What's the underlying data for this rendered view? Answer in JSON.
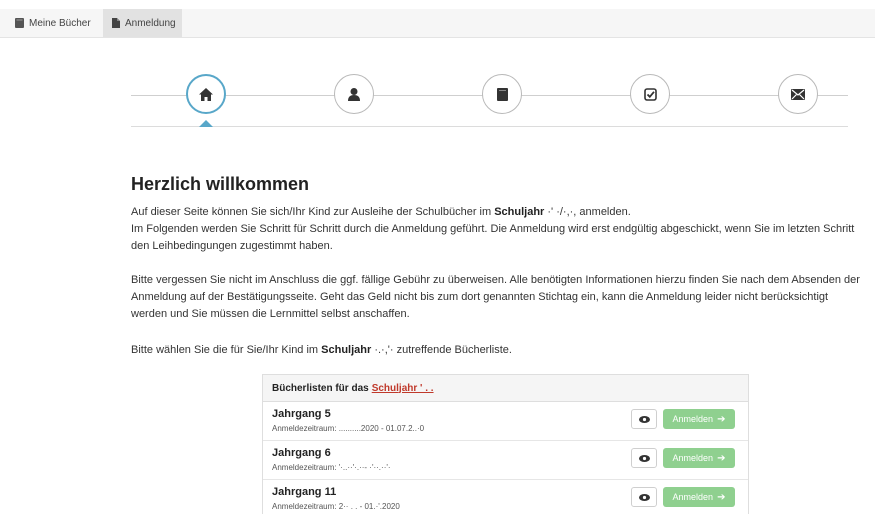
{
  "nav": {
    "tabs": [
      {
        "label": "Meine Bücher",
        "icon": "book-icon"
      },
      {
        "label": "Anmeldung",
        "icon": "document-icon"
      }
    ],
    "active_tab": "Anmeldung"
  },
  "stepper": {
    "steps": [
      "home-icon",
      "user-icon",
      "book-icon",
      "check-square-icon",
      "envelope-icon"
    ],
    "active": 0,
    "accent": "#58a7c9"
  },
  "content": {
    "title": "Herzlich willkommen",
    "p1_a": "Auf dieser Seite können Sie sich/Ihr Kind zur Ausleihe der Schulbücher im ",
    "p1_bold": "Schuljahr",
    "p1_b": " ·' ·/·,·, anmelden.",
    "p1_c": "Im Folgenden werden Sie Schritt für Schritt durch die Anmeldung geführt. Die Anmeldung wird erst endgültig abgeschickt, wenn Sie im letzten Schritt den Leihbedingungen zugestimmt haben.",
    "p2": "Bitte vergessen Sie nicht im Anschluss die ggf. fällige Gebühr zu überweisen. Alle benötigten Informationen hierzu finden Sie nach dem Absenden der Anmeldung auf der Bestätigungsseite. Geht das Geld nicht bis zum dort genannten Stichtag ein, kann die Anmeldung leider nicht berücksichtigt werden und Sie müssen die Lernmittel selbst anschaffen.",
    "p3_a": "Bitte wählen Sie die für Sie/Ihr Kind im ",
    "p3_bold": "Schuljahr",
    "p3_b": " ·.·,'· zutreffende Bücherliste."
  },
  "booklist": {
    "header": "Bücherlisten für das",
    "header_year": "Schuljahr ' . .",
    "rows": [
      {
        "title": "Jahrgang 5",
        "period": "Anmeldezeitraum: ..........2020 - 01.07.2..·0",
        "button": "Anmelden"
      },
      {
        "title": "Jahrgang 6",
        "period": "Anmeldezeitraum: '·..··'·.··- ·'··.··'·",
        "button": "Anmelden"
      },
      {
        "title": "Jahrgang 11",
        "period": "Anmeldezeitraum: 2·· . . - 01.·'.2020",
        "button": "Anmelden"
      }
    ],
    "button_color": "#8fd08f"
  }
}
